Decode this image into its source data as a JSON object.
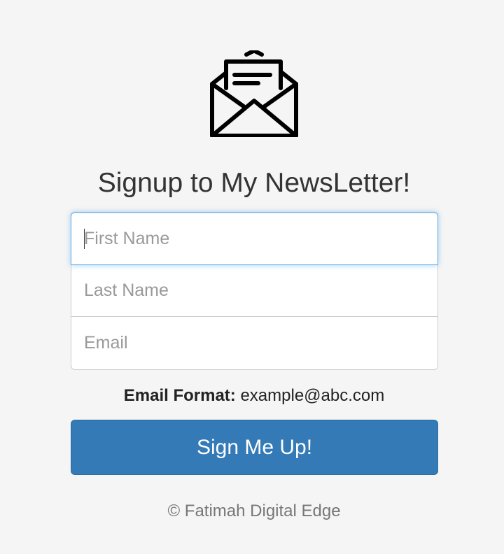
{
  "app": {
    "logo_icon": "open-envelope-with-letter-icon"
  },
  "heading": {
    "title": "Signup to My NewsLetter!"
  },
  "form": {
    "first_name": {
      "placeholder": "First Name",
      "value": ""
    },
    "last_name": {
      "placeholder": "Last Name",
      "value": ""
    },
    "email": {
      "placeholder": "Email",
      "value": ""
    },
    "format_label": "Email Format:",
    "format_example": "example@abc.com",
    "submit_label": "Sign Me Up!"
  },
  "footer": {
    "text": "© Fatimah Digital Edge"
  },
  "colors": {
    "background": "#f5f5f5",
    "primary_button": "#337ab7",
    "focus_border": "#66afe9"
  }
}
